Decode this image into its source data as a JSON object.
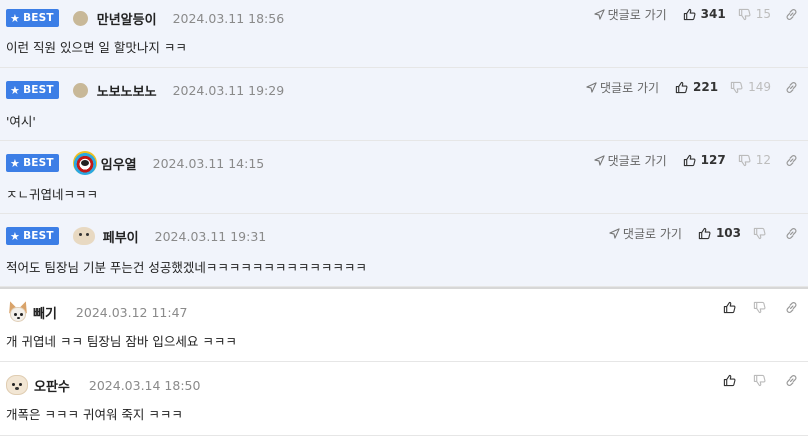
{
  "comments": [
    {
      "best": true,
      "badge": "BEST",
      "nickname": "만년알등이",
      "date": "2024.03.11 18:56",
      "text": "이런 직원 있으면 일 할맛나지 ㅋㅋ",
      "reply_label": "댓글로 가기",
      "likes": "341",
      "dislikes": "15",
      "avatar_icon": "dot-avatar-icon"
    },
    {
      "best": true,
      "badge": "BEST",
      "nickname": "노보노보노",
      "date": "2024.03.11 19:29",
      "text": "'여시'",
      "reply_label": "댓글로 가기",
      "likes": "221",
      "dislikes": "149",
      "avatar_icon": "dot-avatar-icon"
    },
    {
      "best": true,
      "badge": "BEST",
      "nickname": "임우열",
      "date": "2024.03.11 14:15",
      "text": "ㅈㄴ귀엽네ㅋㅋㅋ",
      "reply_label": "댓글로 가기",
      "likes": "127",
      "dislikes": "12",
      "avatar_icon": "lion-avatar-icon"
    },
    {
      "best": true,
      "badge": "BEST",
      "nickname": "페부이",
      "date": "2024.03.11 19:31",
      "text": "적어도 팀장님 기분 푸는건 성공했겠네ㅋㅋㅋㅋㅋㅋㅋㅋㅋㅋㅋㅋㅋㅋ",
      "reply_label": "댓글로 가기",
      "likes": "103",
      "dislikes": "",
      "avatar_icon": "puppy-avatar-icon"
    },
    {
      "best": false,
      "badge": "",
      "nickname": "빼기",
      "date": "2024.03.12 11:47",
      "text": "개 귀엽네 ㅋㅋ 팀장님 잠바 입으세요 ㅋㅋㅋ",
      "reply_label": "",
      "likes": "",
      "dislikes": "",
      "avatar_icon": "chihuahua-avatar-icon"
    },
    {
      "best": false,
      "badge": "",
      "nickname": "오판수",
      "date": "2024.03.14 18:50",
      "text": "개폭은 ㅋㅋㅋ 귀여워 죽지 ㅋㅋㅋ",
      "reply_label": "",
      "likes": "",
      "dislikes": "",
      "avatar_icon": "puppy-avatar-icon"
    }
  ],
  "colors": {
    "best_bg": "#f1f4fb",
    "badge": "#3c7ee6",
    "date": "#8a8a8a"
  }
}
